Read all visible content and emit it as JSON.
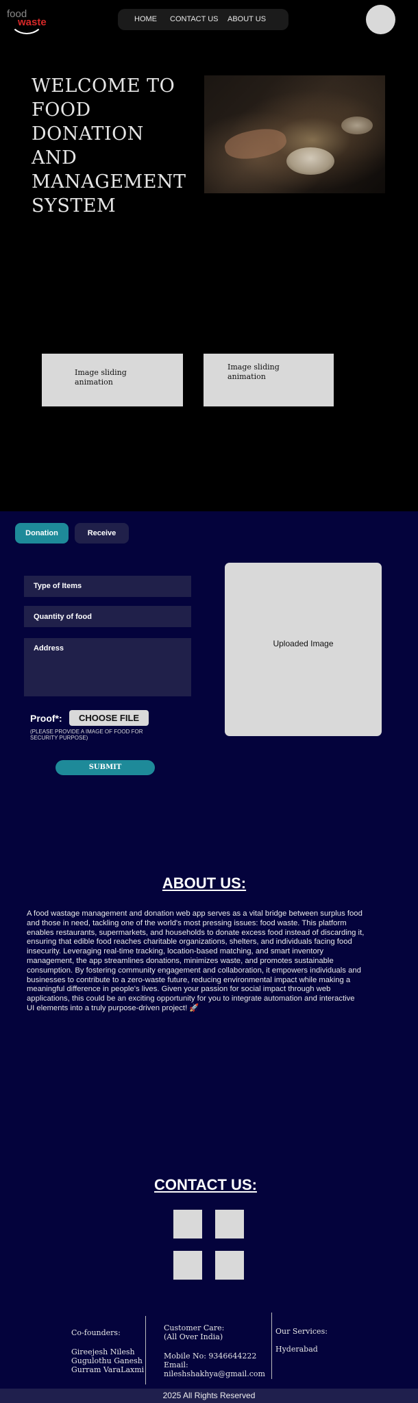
{
  "header": {
    "logo_top": "food",
    "logo_bottom": "waste",
    "nav": [
      "HOME",
      "CONTACT US",
      "ABOUT US"
    ]
  },
  "hero": {
    "title_lines": [
      "WELCOME TO",
      "FOOD DONATION",
      "AND",
      "MANAGEMENT",
      "SYSTEM"
    ]
  },
  "slides": {
    "left": [
      "Image sliding",
      "animation"
    ],
    "right": [
      "Image sliding",
      "animation"
    ]
  },
  "donation_form": {
    "tabs": [
      "Donation",
      "Receive"
    ],
    "type_of_items": "Type of Items",
    "quantity": "Quantity of food",
    "address": "Address",
    "proof_label": "Proof*:",
    "choose_file": "CHOOSE FILE",
    "proof_note_1": "(PLEASE PROVIDE A IMAGE OF FOOD FOR",
    "proof_note_2": "SECURITY PURPOSE)",
    "submit": "SUBMIT",
    "uploaded_image": "Uploaded Image"
  },
  "about": {
    "heading": "ABOUT US:",
    "lines": [
      "A food wastage management and donation web app serves as a vital bridge between surplus food",
      "and those in need, tackling one of the world's most pressing issues: food waste. This platform",
      "enables restaurants, supermarkets, and households to donate excess food instead of discarding it,",
      "ensuring that edible food reaches charitable organizations, shelters, and individuals facing food",
      "insecurity. Leveraging real-time tracking, location-based matching, and smart inventory",
      "management, the app streamlines donations, minimizes waste, and promotes sustainable",
      "consumption. By fostering community engagement and collaboration, it empowers individuals and",
      "businesses to contribute to a zero-waste future, reducing environmental impact while making a",
      "meaningful difference in people's lives. Given your passion for social impact through web",
      "applications, this could be an exciting opportunity for you to integrate automation and interactive",
      "UI elements into a truly purpose-driven project! 🚀"
    ]
  },
  "contact": {
    "heading": "CONTACT US:"
  },
  "footer": {
    "cofounders_title": "Co-founders:",
    "cofounders": [
      "Gireejesh Nilesh",
      "Gugulothu Ganesh",
      "Gurram VaraLaxmi"
    ],
    "care_title_1": "Customer Care:",
    "care_title_2": "(All Over India)",
    "mobile": "Mobile No: 9346644222",
    "email_label": "Email:",
    "email": "nileshshakhya@gmail.com",
    "services_title": "Our Services:",
    "services": [
      "Hyderabad"
    ],
    "copyright": "2025 All Rights Reserved"
  },
  "colors": {
    "navy": "#04033c",
    "teal": "#1e8a99",
    "field": "#20204a",
    "logo_red": "#d62828"
  }
}
